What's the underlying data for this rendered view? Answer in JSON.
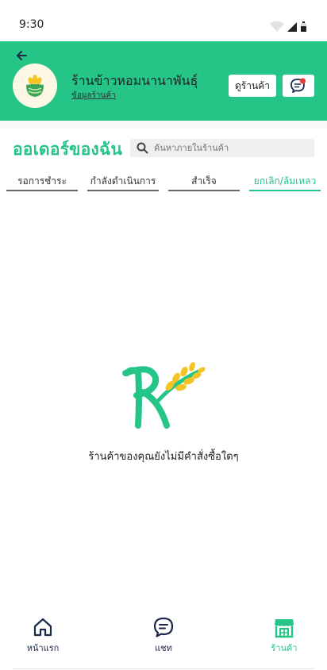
{
  "status_bar": {
    "time": "9:30"
  },
  "shop": {
    "name": "ร้านข้าวหอมนานาพันธุ์",
    "info_link": "ข้อมูลร้านค้า",
    "view_shop_label": "ดูร้านค้า",
    "chat_badge_count": ""
  },
  "page": {
    "title": "ออเดอร์ของฉัน",
    "search_placeholder": "ค้นหาภายในร้านค้า"
  },
  "tabs": [
    {
      "label": "รอการชำระ",
      "active": false
    },
    {
      "label": "กำลังดำเนินการ",
      "active": false
    },
    {
      "label": "สำเร็จ",
      "active": false
    },
    {
      "label": "ยกเลิก/ล้มเหลว",
      "active": true
    }
  ],
  "empty_state": {
    "message": "ร้านค้าของคุณยังไม่มีคำสั่งซื้อใดๆ"
  },
  "bottom_nav": [
    {
      "label": "หน้าแรก",
      "icon": "home-icon",
      "active": false
    },
    {
      "label": "แชท",
      "icon": "chat-icon",
      "active": false
    },
    {
      "label": "ร้านค้า",
      "icon": "store-icon",
      "active": true
    }
  ],
  "colors": {
    "brand_green": "#25c487",
    "nav_dark": "#1c2a4a",
    "badge_red": "#e53935",
    "rice_yellow": "#f6c324"
  }
}
